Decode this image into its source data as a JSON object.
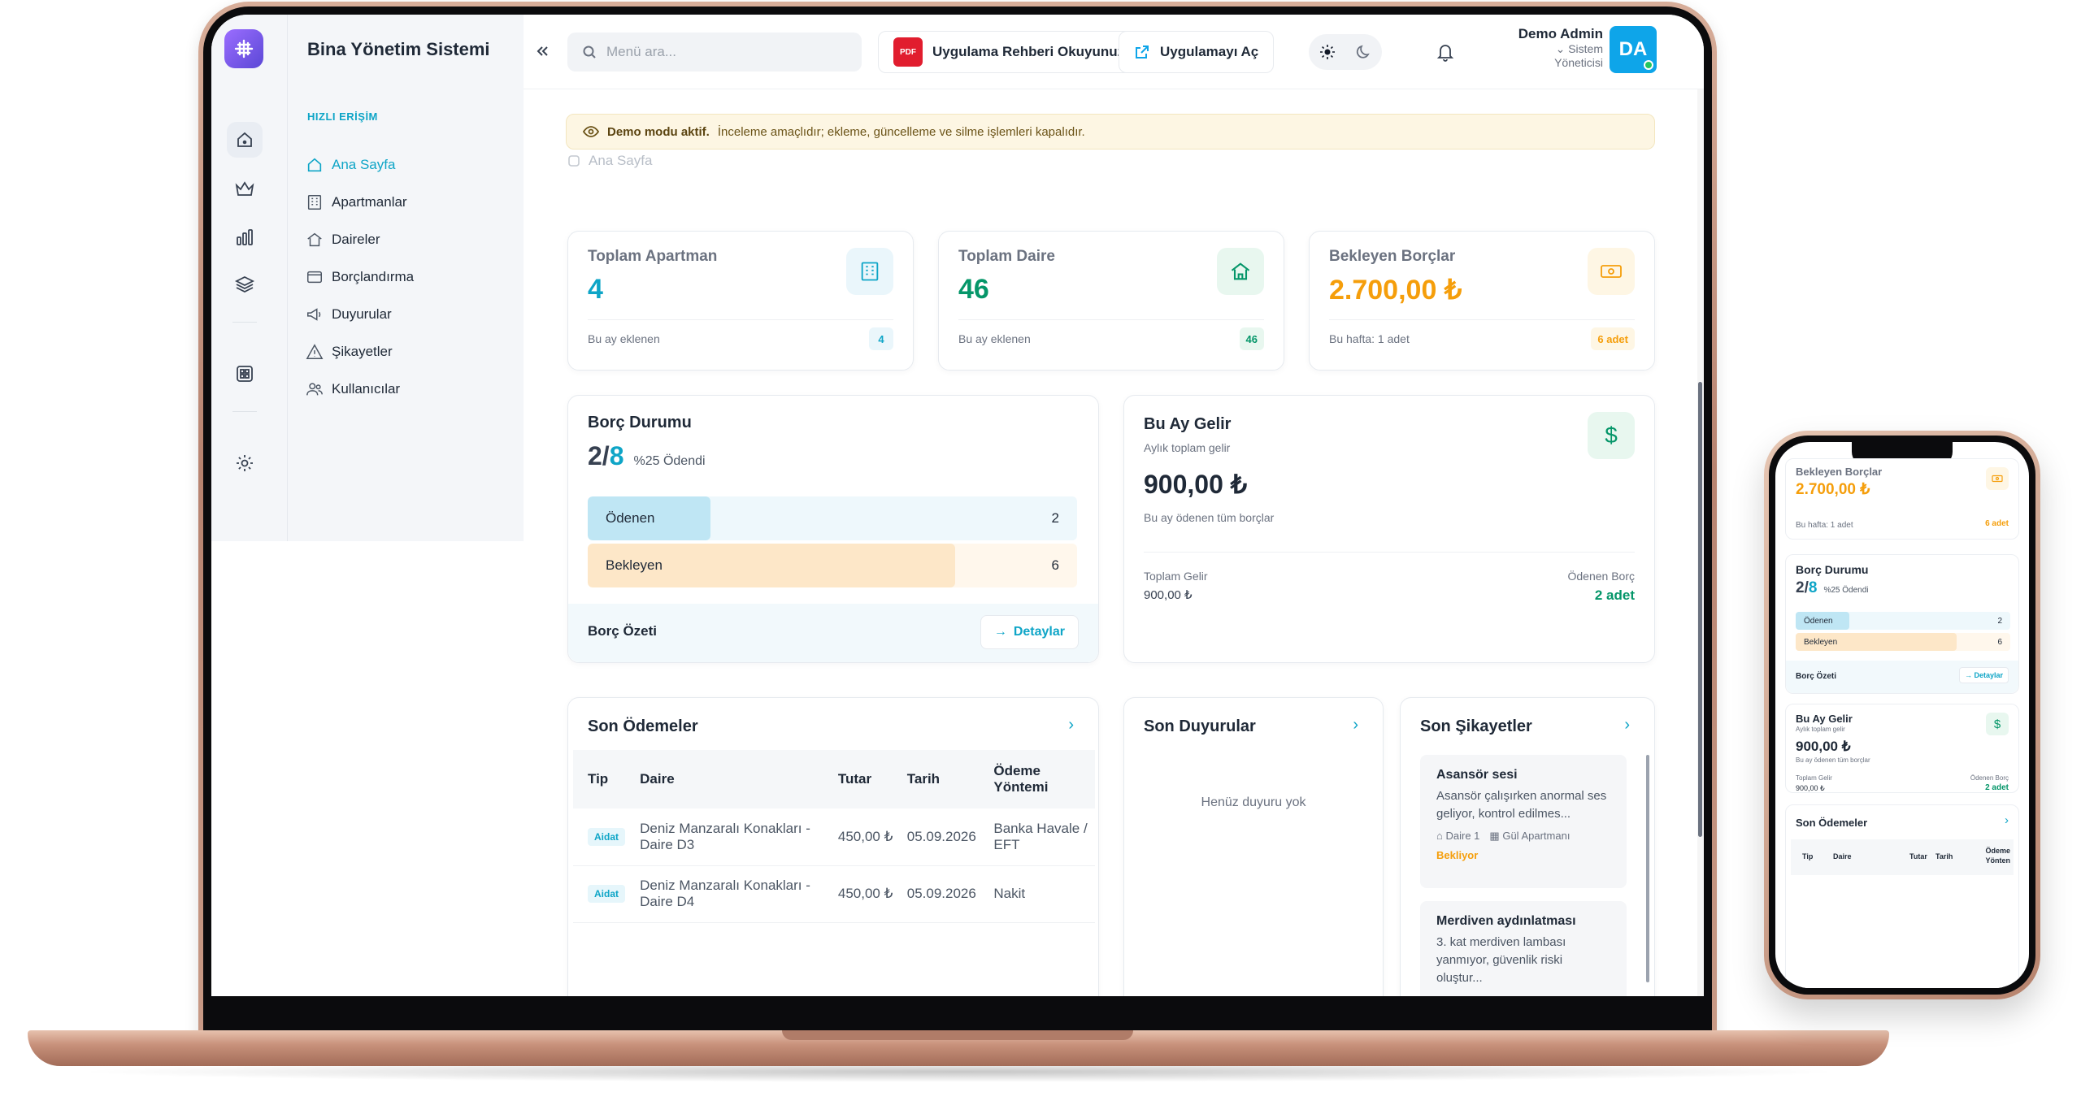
{
  "app": {
    "title": "Bina Yönetim Sistemi"
  },
  "sidebar": {
    "section_label": "HIZLI ERİŞİM",
    "items": [
      {
        "label": "Ana Sayfa",
        "icon": "home-icon",
        "active": true
      },
      {
        "label": "Apartmanlar",
        "icon": "building-icon"
      },
      {
        "label": "Daireler",
        "icon": "house-icon"
      },
      {
        "label": "Borçlandırma",
        "icon": "card-icon"
      },
      {
        "label": "Duyurular",
        "icon": "megaphone-icon"
      },
      {
        "label": "Şikayetler",
        "icon": "warning-icon"
      },
      {
        "label": "Kullanıcılar",
        "icon": "users-icon"
      }
    ]
  },
  "topbar": {
    "search_placeholder": "Menü ara...",
    "guide_label": "Uygulama Rehberi Okuyunuz",
    "pdf_badge": "PDF",
    "open_app_label": "Uygulamayı Aç",
    "user_name": "Demo Admin",
    "user_role_line1": "Sistem",
    "user_role_line2": "Yöneticisi",
    "avatar_initials": "DA"
  },
  "notice": {
    "strong": "Demo modu aktif.",
    "text": "İnceleme amaçlıdır; ekleme, güncelleme ve silme işlemleri kapalıdır."
  },
  "breadcrumb": "Ana Sayfa",
  "stats": [
    {
      "label": "Toplam Apartman",
      "value": "4",
      "footer": "Bu ay eklenen",
      "pill": "4",
      "color": "#0ea5c7"
    },
    {
      "label": "Toplam Daire",
      "value": "46",
      "footer": "Bu ay eklenen",
      "pill": "46",
      "color": "#059669"
    },
    {
      "label": "Bekleyen Borçlar",
      "value": "2.700,00 ₺",
      "footer": "Bu hafta: 1 adet",
      "pill": "6 adet",
      "color": "#f59e0b"
    }
  ],
  "debt": {
    "title": "Borç Durumu",
    "paid": "2",
    "slash": "/",
    "total": "8",
    "percent_text": "%25 Ödendi",
    "rows": [
      {
        "label": "Ödenen",
        "value": "2",
        "fraction": 0.25,
        "color": "#bfe6f4",
        "bg": "#eef8fc"
      },
      {
        "label": "Bekleyen",
        "value": "6",
        "fraction": 0.75,
        "color": "#fde7c8",
        "bg": "#fff7ec"
      }
    ],
    "summary": "Borç Özeti",
    "details": "Detaylar"
  },
  "income": {
    "title": "Bu Ay Gelir",
    "subtitle": "Aylık toplam gelir",
    "value": "900,00 ₺",
    "note": "Bu ay ödenen tüm borçlar",
    "total_label": "Toplam Gelir",
    "total_value": "900,00 ₺",
    "paid_label": "Ödenen Borç",
    "paid_value": "2 adet"
  },
  "payments": {
    "title": "Son Ödemeler",
    "columns": [
      "Tip",
      "Daire",
      "Tutar",
      "Tarih",
      "Ödeme Yöntemi"
    ],
    "rows": [
      {
        "type": "Aidat",
        "unit": "Deniz Manzaralı Konakları - Daire D3",
        "amount": "450,00 ₺",
        "date": "05.09.2026",
        "method": "Banka Havale / EFT"
      },
      {
        "type": "Aidat",
        "unit": "Deniz Manzaralı Konakları - Daire D4",
        "amount": "450,00 ₺",
        "date": "05.09.2026",
        "method": "Nakit"
      }
    ]
  },
  "announcements": {
    "title": "Son Duyurular",
    "empty": "Henüz duyuru yok"
  },
  "complaints": {
    "title": "Son Şikayetler",
    "items": [
      {
        "title": "Asansör sesi",
        "text": "Asansör çalışırken anormal ses geliyor, kontrol edilmes...",
        "unit": "Daire 1",
        "building": "Gül Apartmanı",
        "status": "Bekliyor"
      },
      {
        "title": "Merdiven aydınlatması",
        "text": "3. kat merdiven lambası yanmıyor, güvenlik riski oluştur..."
      }
    ]
  },
  "phone": {
    "pending_label": "Bekleyen Borçlar",
    "pending_value": "2.700,00 ₺",
    "pending_footer": "Bu hafta: 1 adet",
    "pending_pill": "6 adet",
    "debt_title": "Borç Durumu",
    "debt_paid": "2",
    "debt_total": "8",
    "debt_percent": "%25 Ödendi",
    "paid_label": "Ödenen",
    "paid_value": "2",
    "wait_label": "Bekleyen",
    "wait_value": "6",
    "summary": "Borç Özeti",
    "details": "Detaylar",
    "income_title": "Bu Ay Gelir",
    "income_sub": "Aylık toplam gelir",
    "income_value": "900,00 ₺",
    "income_note": "Bu ay ödenen tüm borçlar",
    "total_label": "Toplam Gelir",
    "total_value": "900,00 ₺",
    "pdebt_label": "Ödenen Borç",
    "pdebt_value": "2 adet",
    "payments_title": "Son Ödemeler",
    "cols": [
      "Tip",
      "Daire",
      "Tutar",
      "Tarih",
      "Ödeme",
      "Yönten"
    ]
  }
}
